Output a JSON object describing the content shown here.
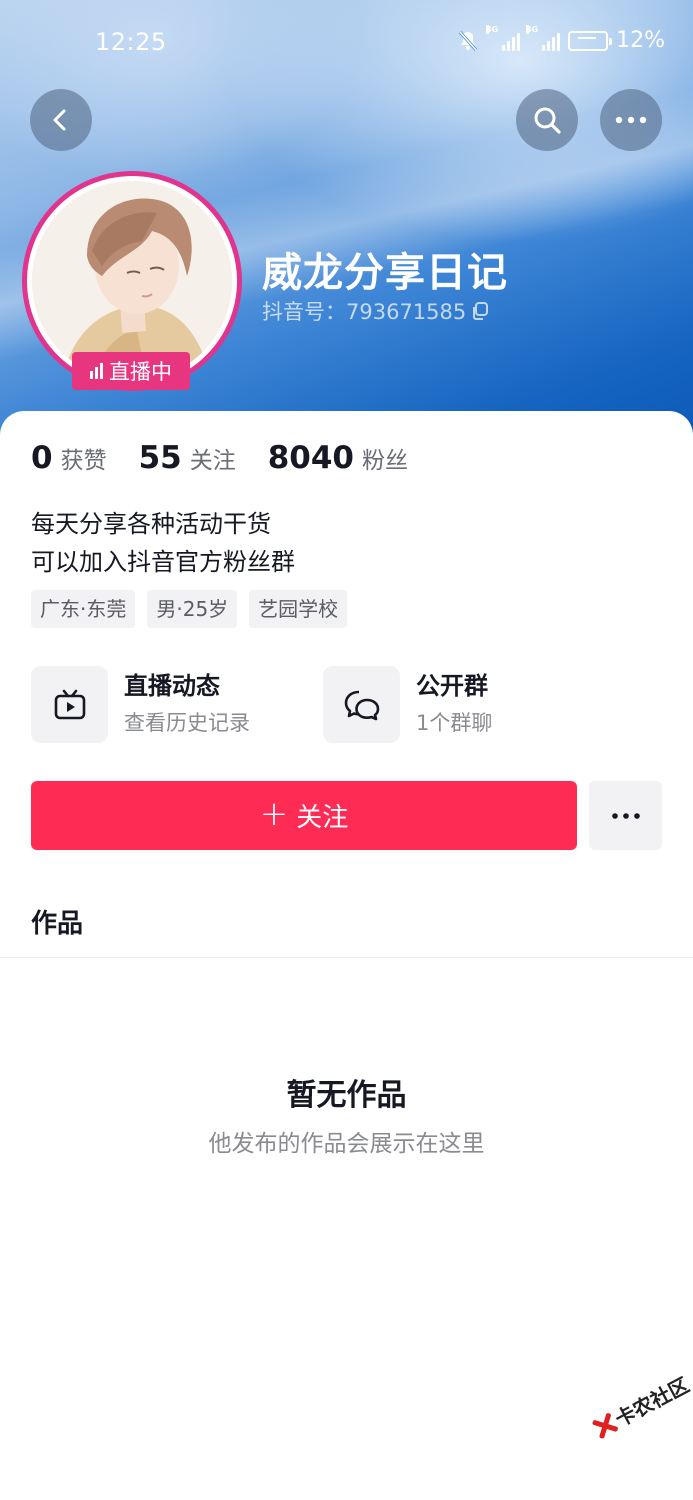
{
  "status_bar": {
    "time": "12:25",
    "network_1": "4G",
    "network_2": "4G",
    "battery": "12%"
  },
  "nav": {
    "back_icon": "chevron-left-icon",
    "search_icon": "search-icon",
    "more_icon": "more-horizontal-icon"
  },
  "profile": {
    "nickname": "威龙分享日记",
    "douyin_id": "抖音号：793671585",
    "live_badge": "直播中",
    "stats": [
      {
        "num": "0",
        "label": "获赞"
      },
      {
        "num": "55",
        "label": "关注"
      },
      {
        "num": "8040",
        "label": "粉丝"
      }
    ],
    "bio_lines": [
      "每天分享各种活动干货",
      "可以加入抖音官方粉丝群"
    ],
    "tags": [
      "广东·东莞",
      "男·25岁",
      "艺园学校"
    ]
  },
  "features": {
    "live": {
      "title": "直播动态",
      "subtitle": "查看历史记录",
      "icon": "tv-play-icon"
    },
    "group": {
      "title": "公开群",
      "subtitle": "1个群聊",
      "icon": "chat-bubbles-icon"
    }
  },
  "actions": {
    "follow_label": "关注",
    "more_icon": "more-horizontal-icon"
  },
  "works": {
    "title": "作品",
    "empty_title": "暂无作品",
    "empty_subtitle": "他发布的作品会展示在这里"
  },
  "watermark": "卡农社区",
  "colors": {
    "accent": "#fe2c55",
    "live_pink": "#e8357f",
    "header_blue": "#1665c1"
  }
}
